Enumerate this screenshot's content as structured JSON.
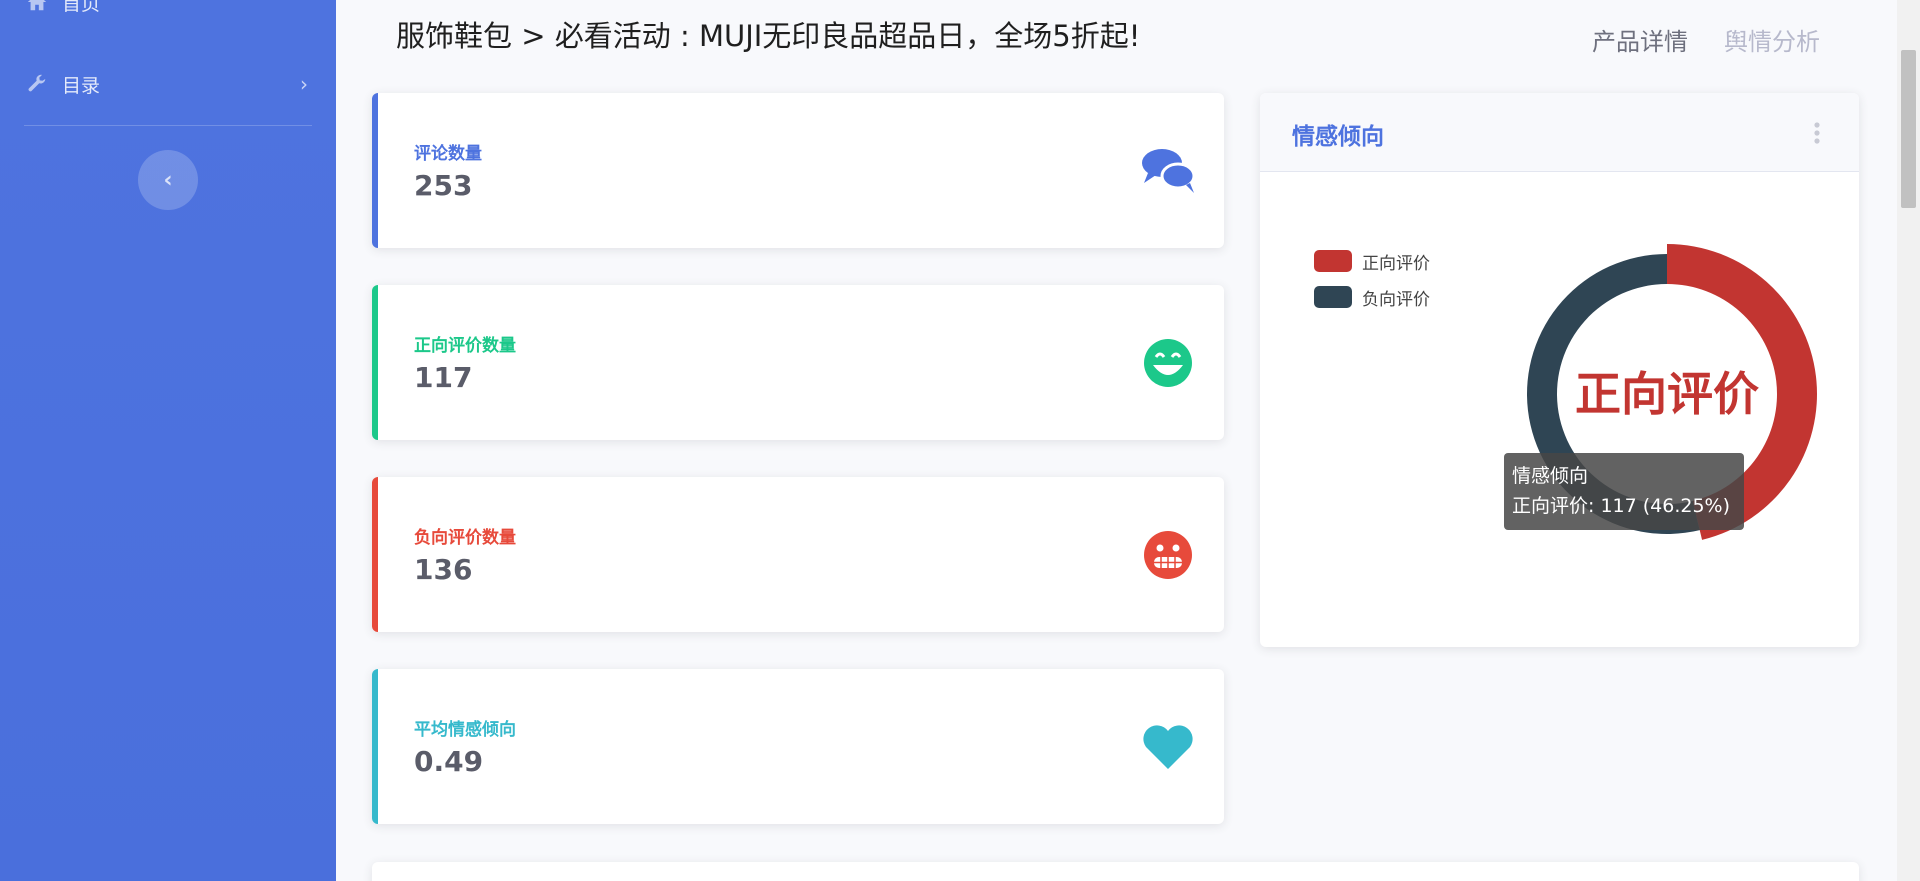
{
  "sidebar": {
    "home_label": "首页",
    "catalog_label": "目录",
    "catalog_chevron": "›",
    "toggle_glyph": "‹"
  },
  "header": {
    "title": "服饰鞋包 > 必看活动 : MUJI无印良品超品日，全场5折起!",
    "links": [
      "产品详情",
      "舆情分析"
    ]
  },
  "stats": [
    {
      "label": "评论数量",
      "value": "253",
      "color": "#4e73df",
      "icon": "comments-icon"
    },
    {
      "label": "正向评价数量",
      "value": "117",
      "color": "#1cc88a",
      "icon": "grin-icon"
    },
    {
      "label": "负向评价数量",
      "value": "136",
      "color": "#e74a3b",
      "icon": "grimace-icon"
    },
    {
      "label": "平均情感倾向",
      "value": "0.49",
      "color": "#36b9cc",
      "icon": "heart-icon"
    }
  ],
  "panel": {
    "title": "情感倾向"
  },
  "chart_data": {
    "type": "pie",
    "categories": [
      "正向评价",
      "负向评价"
    ],
    "values": [
      117,
      136
    ],
    "colors": [
      "#c23531",
      "#2f4554"
    ],
    "center_label": "正向评价",
    "highlighted": "正向评价",
    "legend_position": "top-left",
    "tooltip": {
      "title": "情感倾向",
      "text": "正向评价: 117 (46.25%)"
    }
  }
}
